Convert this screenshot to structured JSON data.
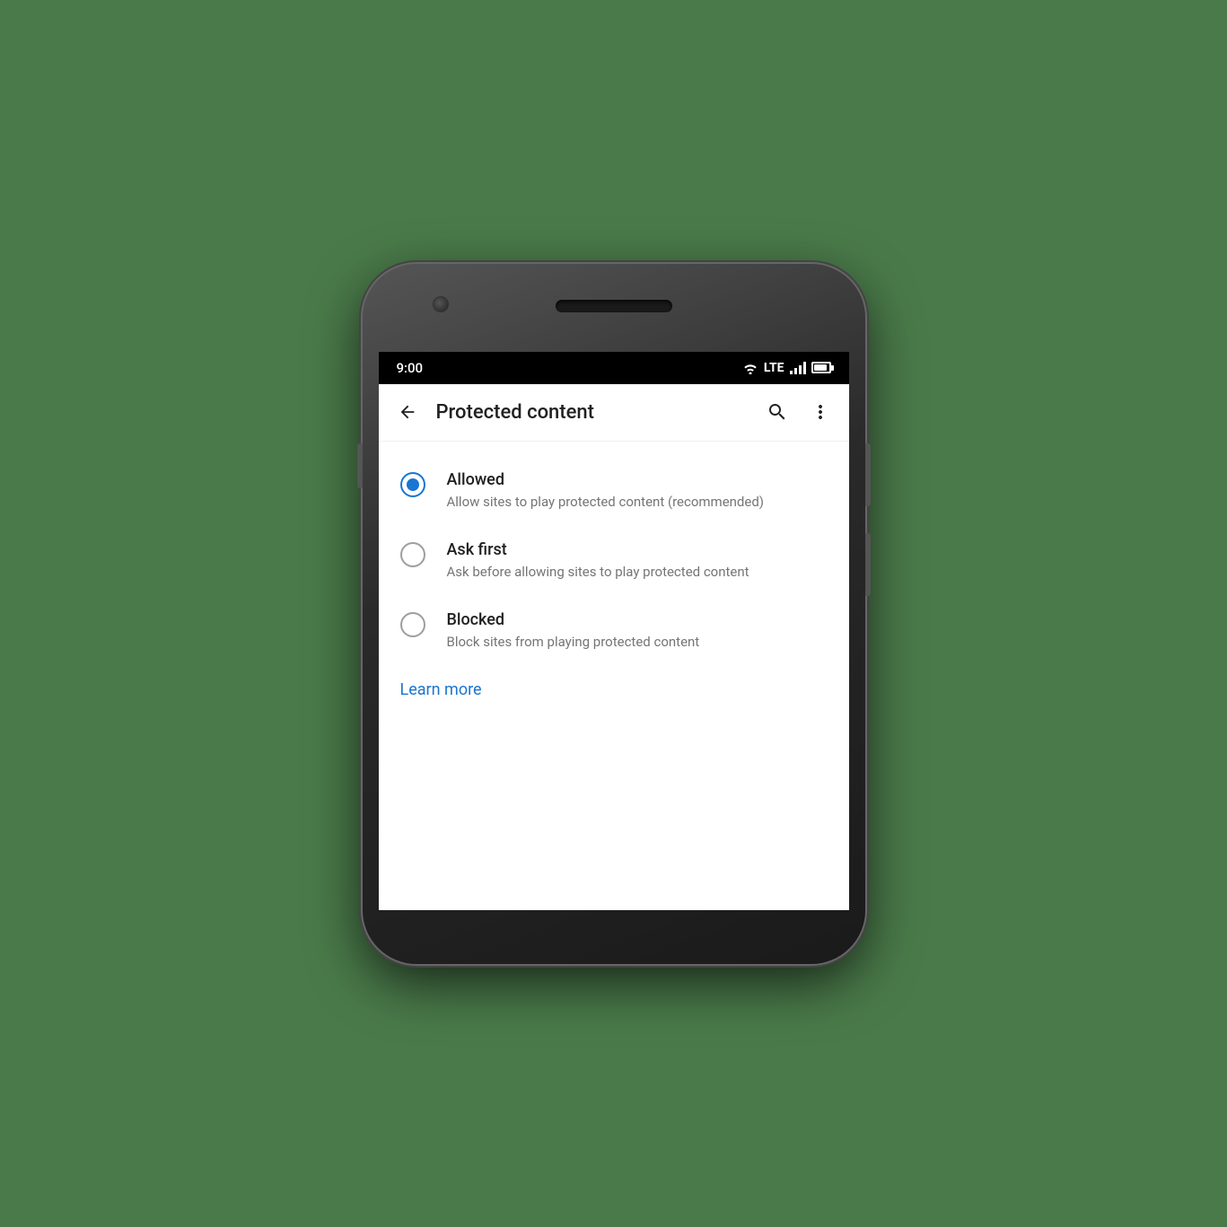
{
  "status": {
    "time": "9:00",
    "lte_label": "LTE"
  },
  "app_bar": {
    "title": "Protected content",
    "back_label": "Back",
    "search_label": "Search",
    "more_label": "More options"
  },
  "options": [
    {
      "id": "allowed",
      "label": "Allowed",
      "description": "Allow sites to play protected content (recommended)",
      "selected": true
    },
    {
      "id": "ask_first",
      "label": "Ask first",
      "description": "Ask before allowing sites to play protected content",
      "selected": false
    },
    {
      "id": "blocked",
      "label": "Blocked",
      "description": "Block sites from playing protected content",
      "selected": false
    }
  ],
  "learn_more": {
    "label": "Learn more"
  }
}
